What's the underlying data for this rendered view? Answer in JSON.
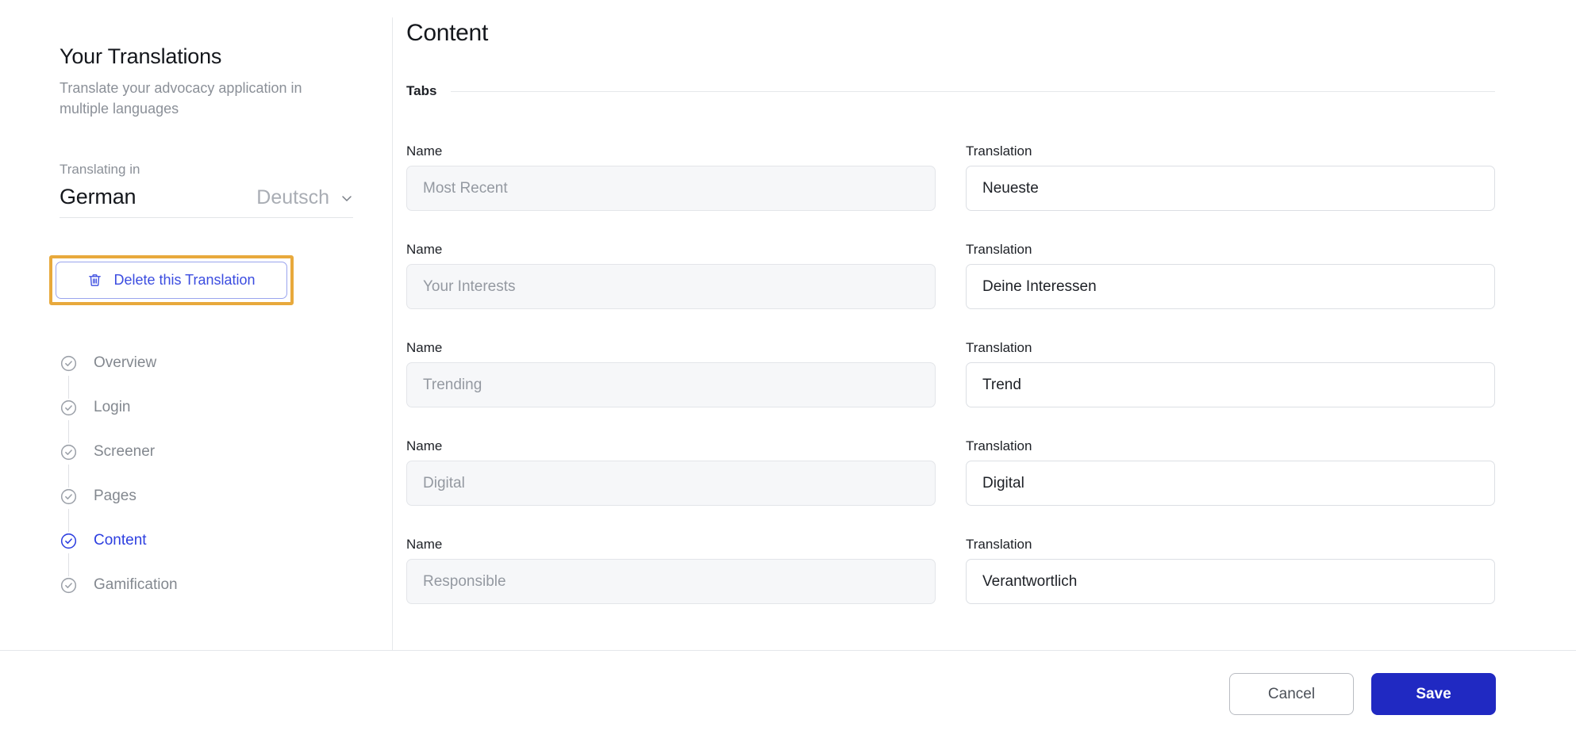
{
  "sidebar": {
    "title": "Your Translations",
    "subtitle": "Translate your advocacy application in multiple languages",
    "language": {
      "label": "Translating in",
      "name": "German",
      "native": "Deutsch",
      "chevron_icon": "chevron-down-icon"
    },
    "delete_button": {
      "label": "Delete this Translation",
      "icon": "trash-icon",
      "highlight_color": "#e8a93c",
      "text_color": "#3b4ce0"
    },
    "steps": [
      {
        "label": "Overview",
        "icon": "check-circle-icon",
        "active": false
      },
      {
        "label": "Login",
        "icon": "check-circle-icon",
        "active": false
      },
      {
        "label": "Screener",
        "icon": "check-circle-icon",
        "active": false
      },
      {
        "label": "Pages",
        "icon": "check-circle-icon",
        "active": false
      },
      {
        "label": "Content",
        "icon": "check-circle-icon",
        "active": true
      },
      {
        "label": "Gamification",
        "icon": "check-circle-icon",
        "active": false
      }
    ]
  },
  "main": {
    "title": "Content",
    "section": {
      "label": "Tabs"
    },
    "column_labels": {
      "name": "Name",
      "translation": "Translation"
    },
    "rows": [
      {
        "name": "Most Recent",
        "translation": "Neueste"
      },
      {
        "name": "Your Interests",
        "translation": "Deine Interessen"
      },
      {
        "name": "Trending",
        "translation": "Trend"
      },
      {
        "name": "Digital",
        "translation": "Digital"
      },
      {
        "name": "Responsible",
        "translation": "Verantwortlich"
      }
    ]
  },
  "footer": {
    "cancel_label": "Cancel",
    "save_label": "Save",
    "save_color": "#2029c2"
  }
}
